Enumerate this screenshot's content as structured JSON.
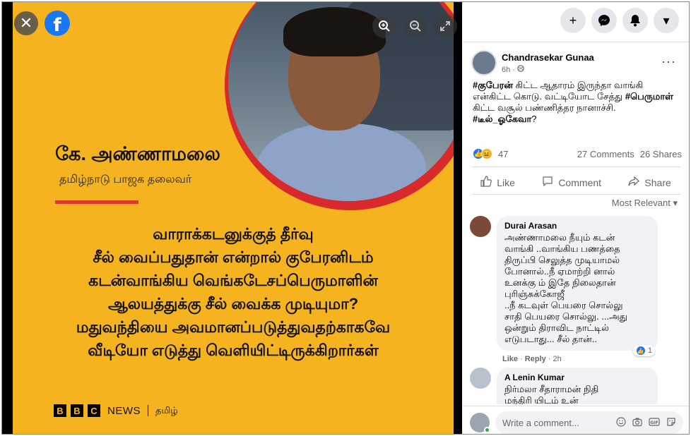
{
  "viewer": {
    "close_icon": "close-icon",
    "brand_icon": "facebook-logo",
    "zoom_in_icon": "zoom-in-icon",
    "zoom_out_icon": "zoom-out-icon",
    "fullscreen_icon": "fullscreen-icon",
    "poster": {
      "name": "கே. அண்ணாமலை",
      "role": "தமிழ்நாடு பாஜக தலைவர்",
      "quote_lines": [
        "வாராக்கடனுக்குத் தீர்வு",
        "சீல் வைப்பதுதான் என்றால்  குபேரனிடம்",
        "கடன்வாங்கிய வெங்கடேசப்பெருமாளின்",
        "ஆலயத்துக்கு சீல் வைக்க முடியுமா?",
        "மதுவந்தியை அவமானப்படுத்துவதற்காகவே",
        "வீடியோ எடுத்து வெளியிட்டிருக்கிறார்கள்"
      ],
      "bbc_letters": [
        "B",
        "B",
        "C"
      ],
      "bbc_news": "NEWS",
      "bbc_lang": "தமிழ்"
    }
  },
  "header": {
    "icons": [
      "plus-icon",
      "messenger-icon",
      "bell-icon",
      "caret-down-icon"
    ],
    "plus": "+",
    "messenger": "✉",
    "bell": "🔔",
    "caret": "▾"
  },
  "post": {
    "author": "Chandrasekar Gunaa",
    "time": "6h ·",
    "privacy_icon": "globe-icon",
    "more": "···",
    "text_parts": [
      {
        "t": "#குபேரன்",
        "tag": true
      },
      {
        "t": " கிட்ட ஆதாரம் இருந்தா வாங்கி என்கிட்ட கொடு. வட்டியோட சேத்து ",
        "tag": false
      },
      {
        "t": "#பெருமாள்",
        "tag": true
      },
      {
        "t": " கிட்ட வசூல் பண்ணித்தர நானாச்சி. ",
        "tag": false
      },
      {
        "t": "#டீல்_ஓகேவா",
        "tag": true
      },
      {
        "t": "?",
        "tag": false
      }
    ],
    "reaction_count": "47",
    "comments_count": "27 Comments",
    "shares_count": "26 Shares",
    "actions": {
      "like": "Like",
      "comment": "Comment",
      "share": "Share"
    },
    "sort_label": "Most Relevant ▾"
  },
  "comments": [
    {
      "author": "Durai Arasan",
      "lines": [
        "அண்ணாமலை நீயும் கடன்",
        "வாங்கி ..வாங்கிய பணத்தை",
        "திருப்பி செலுத்த முடியாமல்",
        "போனால்..நீ ஏமாற்றி னால்",
        "உனக்கு ம் இதே நிலைதான்",
        "புரிஞ்சுக்கோஜீ",
        "..நீ கடவுள் பெயரை சொல்லு",
        "சாதி பெயரை சொல்லு. ...அது",
        "ஒன்றும் திராவிட நாட்டில்",
        "எடுபடாது... சீல் தான்.."
      ],
      "reacts": "1",
      "like_label": "Like",
      "reply_label": "Reply",
      "time": "2h"
    },
    {
      "author": "A Lenin Kumar",
      "lines": [
        "நிர்மலா சீதாராமன் நிதி",
        "மந்திரி யிடம் உன்"
      ]
    }
  ],
  "composer": {
    "placeholder": "Write a comment...",
    "icons": [
      "emoji-icon",
      "camera-icon",
      "gif-icon",
      "sticker-icon"
    ]
  },
  "colors": {
    "poster_bg": "#f4b31f",
    "accent_red": "#e0392e",
    "fb_blue": "#1877f2"
  }
}
